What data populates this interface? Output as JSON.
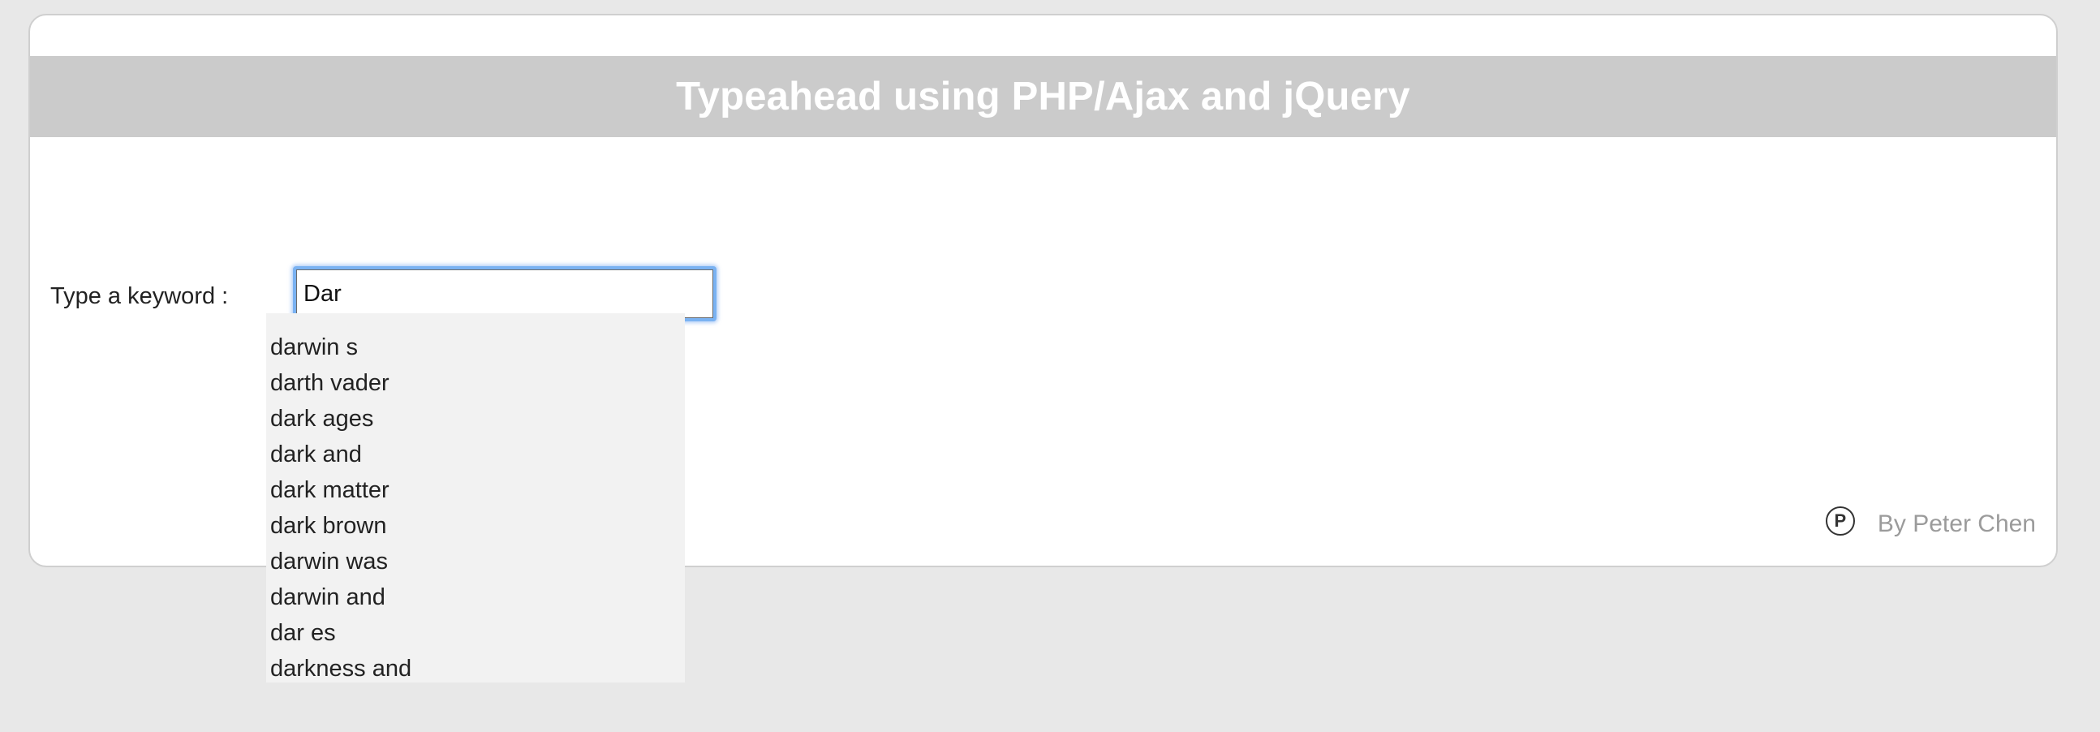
{
  "header": {
    "title": "Typeahead using PHP/Ajax and jQuery"
  },
  "form": {
    "label": "Type a keyword :",
    "input_value": "Dar"
  },
  "suggestions": [
    "darwin s",
    "darth vader",
    "dark ages",
    "dark and",
    "dark matter",
    "dark brown",
    "darwin was",
    "darwin and",
    "dar es",
    "darkness and"
  ],
  "footer": {
    "icon_glyph": "P",
    "icon_name": "p-circle-icon",
    "author": "By Peter Chen"
  },
  "colors": {
    "page_background": "#e8e8e8",
    "title_bar": "#cbcbcb",
    "title_text": "#ffffff",
    "input_focus": "#7ab2f2",
    "suggestion_background": "#f2f2f2",
    "footer_text": "#9b9b9b"
  }
}
